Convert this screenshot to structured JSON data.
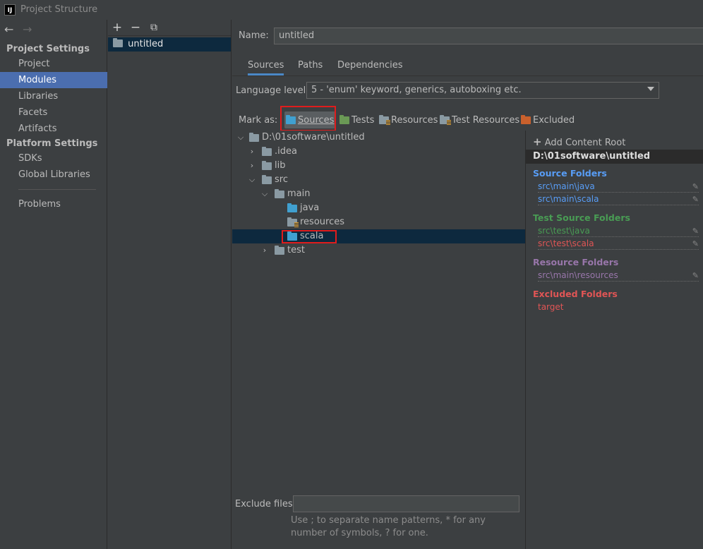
{
  "window": {
    "title": "Project Structure",
    "logo_text": "IJ"
  },
  "nav": {
    "back_glyph": "←",
    "forward_glyph": "→",
    "project_settings_header": "Project Settings",
    "platform_settings_header": "Platform Settings",
    "project_items": [
      "Project",
      "Modules",
      "Libraries",
      "Facets",
      "Artifacts"
    ],
    "platform_items": [
      "SDKs",
      "Global Libraries"
    ],
    "problems": "Problems",
    "selected": "Modules"
  },
  "modules": {
    "add_glyph": "+",
    "remove_glyph": "−",
    "copy_glyph": "⧉",
    "items": [
      "untitled"
    ]
  },
  "main": {
    "name_label": "Name:",
    "name_value": "untitled",
    "tabs": [
      "Sources",
      "Paths",
      "Dependencies"
    ],
    "active_tab": "Sources",
    "language_label": "Language level:",
    "language_value": "5 - 'enum' keyword, generics, autoboxing etc.",
    "mark_as_label": "Mark as:",
    "mark_buttons": {
      "sources": "Sources",
      "tests": "Tests",
      "resources": "Resources",
      "test_resources": "Test Resources",
      "excluded": "Excluded"
    }
  },
  "tree": {
    "root": "D:\\01software\\untitled",
    "idea": ".idea",
    "lib": "lib",
    "src": "src",
    "main": "main",
    "java": "java",
    "resources": "resources",
    "scala": "scala",
    "test": "test"
  },
  "roots": {
    "add_content_root": "Add Content Root",
    "content_root": "D:\\01software\\untitled",
    "source_folders_title": "Source Folders",
    "source_folders": [
      "src\\main\\java",
      "src\\main\\scala"
    ],
    "test_source_folders_title": "Test Source Folders",
    "test_source_folders": [
      "src\\test\\java",
      "src\\test\\scala"
    ],
    "resource_folders_title": "Resource Folders",
    "resource_folders": [
      "src\\main\\resources"
    ],
    "excluded_folders_title": "Excluded Folders",
    "excluded_folders": [
      "target"
    ]
  },
  "exclude": {
    "label": "Exclude files:",
    "value": "",
    "help": "Use ; to separate name patterns, * for any number of symbols, ? for one."
  },
  "colors": {
    "source_blue": "#589df6",
    "test_green": "#499c54",
    "resource_purple": "#9876aa",
    "excluded_red": "#e05555",
    "highlight_red": "#e01c1c"
  }
}
